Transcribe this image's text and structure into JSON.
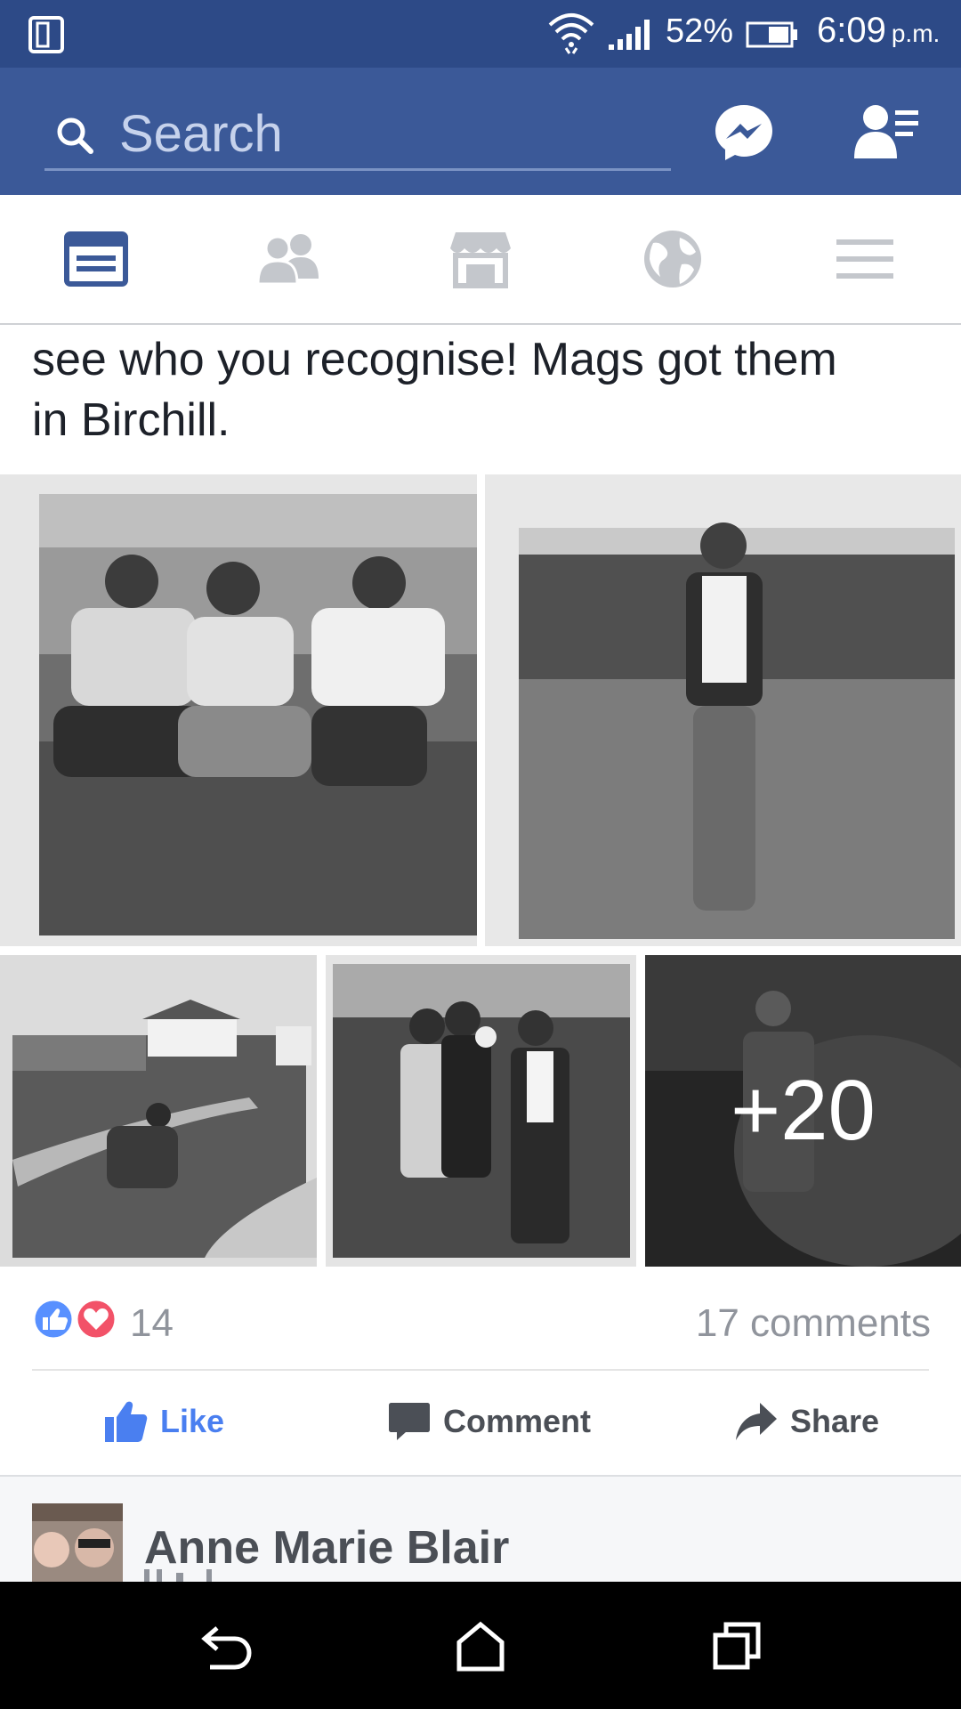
{
  "status_bar": {
    "battery_percent": "52%",
    "time": "6:09",
    "am_pm": "p.m."
  },
  "header": {
    "search_placeholder": "Search",
    "brand_color": "#3b5998"
  },
  "tabs": [
    {
      "icon": "news-feed-icon",
      "active": true
    },
    {
      "icon": "friends-icon",
      "active": false
    },
    {
      "icon": "marketplace-icon",
      "active": false
    },
    {
      "icon": "notifications-globe-icon",
      "active": false
    },
    {
      "icon": "menu-icon",
      "active": false
    }
  ],
  "post": {
    "text_line1": "see who you recognise! Mags got them",
    "text_line2": "in Birchill.",
    "more_photos_label": "+20",
    "reaction_count": "14",
    "comments_label": "17 comments",
    "actions": {
      "like": "Like",
      "comment": "Comment",
      "share": "Share"
    }
  },
  "next_post": {
    "author": "Anne Marie Blair"
  }
}
